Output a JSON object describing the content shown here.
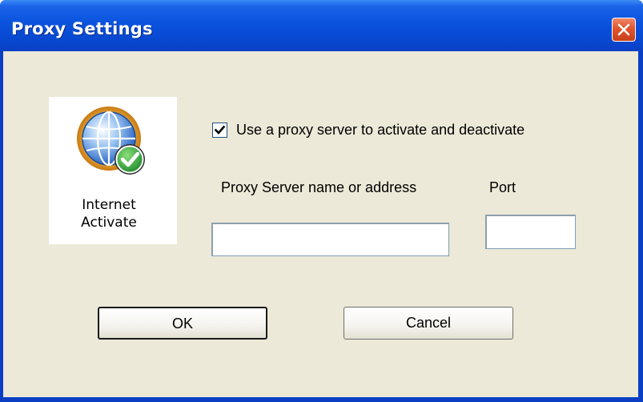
{
  "window": {
    "title": "Proxy Settings"
  },
  "icon_panel": {
    "icon": "internet-globe-check-icon",
    "label_line1": "Internet",
    "label_line2": "Activate"
  },
  "proxy": {
    "use_proxy_label": "Use a proxy server to activate and deactivate",
    "use_proxy_checked": true,
    "server_label": "Proxy Server name or address",
    "server_value": "",
    "port_label": "Port",
    "port_value": ""
  },
  "buttons": {
    "ok_label": "OK",
    "cancel_label": "Cancel"
  },
  "colors": {
    "titlebar": "#0a52dd",
    "dialog_background": "#ece9d8",
    "close_button": "#e0542d"
  }
}
